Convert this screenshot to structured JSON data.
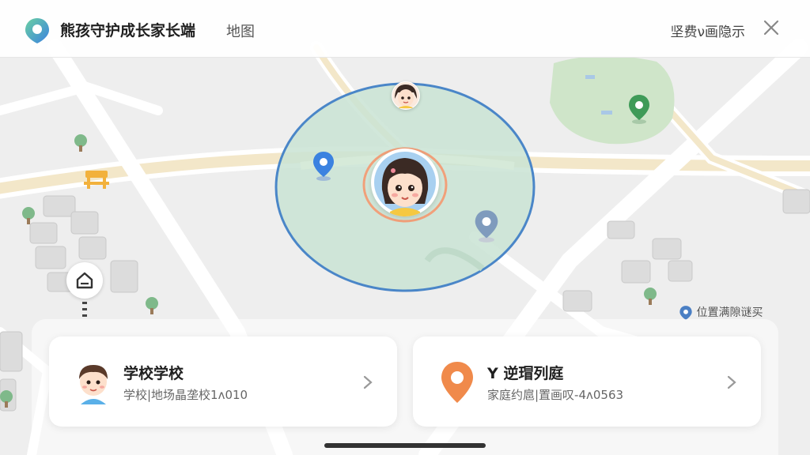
{
  "header": {
    "app_title": "熊孩守护成长家长端",
    "subtitle": "地图",
    "action_label": "坚费ν画隐示"
  },
  "map": {
    "legend_label": "位置满隙谜买"
  },
  "cards": [
    {
      "title": "学校学校",
      "subtitle": "学校|地场晶垄校1ʌ010",
      "icon": "child-avatar-icon"
    },
    {
      "title": "Y 逆瑁列庭",
      "subtitle": "家庭约扈|置画叹-4ʌ0563",
      "icon": "map-pin-icon"
    }
  ],
  "colors": {
    "geofence_fill": "#c9e3d4",
    "geofence_stroke": "#4a86c8",
    "pin_blue": "#3b82e0",
    "pin_orange": "#f08a4b",
    "park_green": "#cfe5c9"
  }
}
